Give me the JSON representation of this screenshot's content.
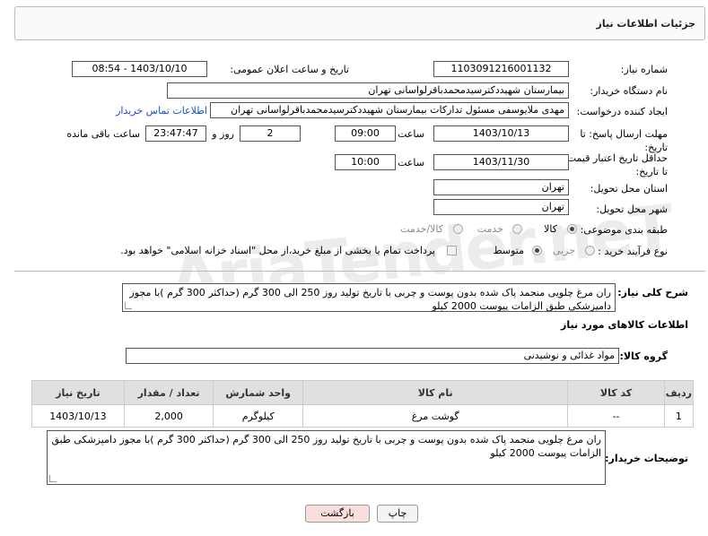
{
  "page_title": "جزئیات اطلاعات نیاز",
  "watermark": "AriaTender.neT",
  "fields": {
    "need_number_label": "شماره نیاز:",
    "need_number": "1103091216001132",
    "announce_label": "تاریخ و ساعت اعلان عمومی:",
    "announce_value": "1403/10/10 - 08:54",
    "buyer_label": "نام دستگاه خریدار:",
    "buyer_value": "بیمارستان شهیددکترسیدمحمدباقرلواسانی تهران",
    "creator_label": "ایجاد کننده درخواست:",
    "creator_value": "مهدی ملایوسفی مسئول تدارکات بیمارستان شهیددکترسیدمحمدباقرلواسانی تهران",
    "contact_link": "اطلاعات تماس خریدار",
    "deadline_label": "مهلت ارسال پاسخ: تا تاریخ:",
    "deadline_date": "1403/10/13",
    "time_label": "ساعت",
    "deadline_time": "09:00",
    "days_value": "2",
    "days_label": "روز و",
    "remaining_time": "23:47:47",
    "remaining_label": "ساعت باقی مانده",
    "validity_label": "حداقل تاریخ اعتبار قیمت: تا تاریخ:",
    "validity_date": "1403/11/30",
    "validity_time": "10:00",
    "province_label": "استان محل تحویل:",
    "province_value": "تهران",
    "city_label": "شهر محل تحویل:",
    "city_value": "تهران",
    "category_label": "طبقه بندی موضوعی:",
    "category_options": [
      "کالا",
      "خدمت",
      "کالا/خدمت"
    ],
    "process_label": "نوع فرآیند خرید :",
    "process_options": [
      "جزیی",
      "متوسط"
    ],
    "payment_note": "پرداخت تمام یا بخشی از مبلغ خرید،از محل \"اسناد خزانه اسلامی\" خواهد بود."
  },
  "description": {
    "label": "شرح کلی نیاز:",
    "text": "ران مرغ چلویی منجمد پاک شده بدون پوست و چربی با تاریخ تولید روز 250 الی 300 گرم (حداکثر 300 گرم )با مجوز دامپزشکی طبق الزامات پیوست 2000 کیلو"
  },
  "goods": {
    "section_title": "اطلاعات کالاهای مورد نیاز",
    "group_label": "گروه کالا:",
    "group_value": "مواد غذائی و نوشیدنی",
    "columns": [
      "ردیف",
      "کد کالا",
      "نام کالا",
      "واحد شمارش",
      "تعداد / مقدار",
      "تاریخ نیاز"
    ],
    "rows": [
      [
        "1",
        "--",
        "گوشت مرغ",
        "کیلوگرم",
        "2,000",
        "1403/10/13"
      ]
    ]
  },
  "buyer_notes": {
    "label": "توضیحات خریدار:",
    "text": "ران مرغ چلویی منجمد پاک شده بدون پوست و چربی با تاریخ تولید روز 250 الی 300 گرم (حداکثر 300 گرم )با مجوز دامپزشکی طبق الزامات پیوست 2000 کیلو"
  },
  "buttons": {
    "print": "چاپ",
    "back": "بازگشت"
  }
}
